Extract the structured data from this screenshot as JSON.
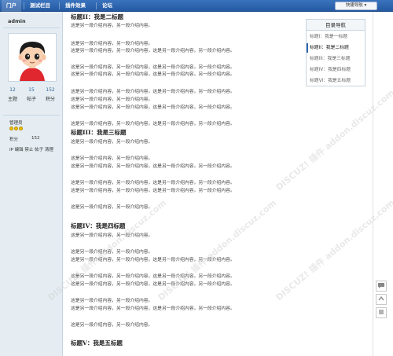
{
  "nav": {
    "items": [
      "门户",
      "测试栏目",
      "插件效果",
      "论坛"
    ],
    "quick_nav": "快捷导航 ▾"
  },
  "profile": {
    "username": "admin",
    "stats": [
      {
        "value": "12",
        "label": "主题"
      },
      {
        "value": "15",
        "label": "帖子"
      },
      {
        "value": "152",
        "label": "积分"
      }
    ],
    "group": "管理员",
    "points_label": "积分",
    "points_value": "152",
    "actions": "IP 编辑 禁止 帖子 清理"
  },
  "content": {
    "headings": {
      "h2": "标题II：我是二标题",
      "h3": "标题III：我是三标题",
      "h4": "标题IV：我是四标题",
      "h5": "标题V：我是五标题"
    },
    "short_line": "这是另一段介绍内容，另一段介绍内容。",
    "long_line": "这是另一段介绍内容，另一段介绍内容，这是另一段介绍内容，另一段介绍内容。"
  },
  "toc": {
    "title": "目录导航",
    "items": [
      "标题I：我是一标题",
      "标题II：我是二标题",
      "标题III：我是三标题",
      "标题IV：我是四标题",
      "标题VI：我是五标题"
    ],
    "active_index": 1
  },
  "watermark": "DISCUZ! 插件 addon.discuz.com",
  "right_tools": [
    "comment-icon",
    "top-icon",
    "list-icon"
  ],
  "colors": {
    "nav_bg": "#2d66b0",
    "sidebar_bg": "#e5edf2",
    "link": "#336699"
  }
}
